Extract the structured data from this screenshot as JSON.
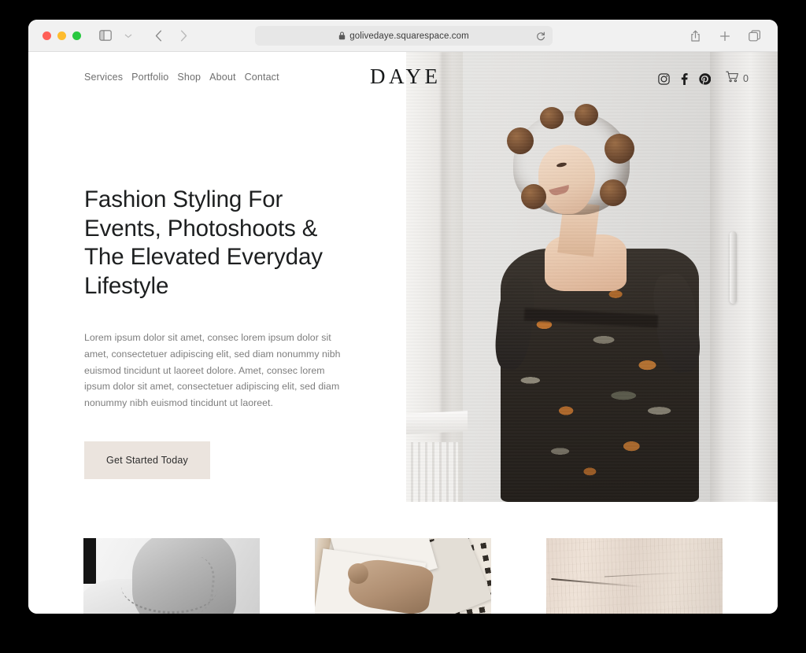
{
  "browser": {
    "url": "golivedaye.squarespace.com",
    "lock_icon": "lock-icon",
    "reload_icon": "reload-icon",
    "sidebar_icon": "sidebar-toggle-icon",
    "chevron_icon": "chevron-down-icon",
    "back_icon": "back-arrow-icon",
    "forward_icon": "forward-arrow-icon",
    "share_icon": "share-icon",
    "new_tab_icon": "plus-icon",
    "tabs_icon": "tabs-overview-icon",
    "traffic_lights": [
      "close-button",
      "minimize-button",
      "maximize-button"
    ]
  },
  "site": {
    "brand": "DAYE",
    "nav": [
      {
        "label": "Services"
      },
      {
        "label": "Portfolio"
      },
      {
        "label": "Shop"
      },
      {
        "label": "About"
      },
      {
        "label": "Contact"
      }
    ],
    "social": [
      {
        "name": "instagram-icon"
      },
      {
        "name": "facebook-icon"
      },
      {
        "name": "pinterest-icon"
      }
    ],
    "cart": {
      "icon": "cart-icon",
      "count": "0"
    },
    "hero": {
      "headline": "Fashion Styling For Events, Photoshoots & The Elevated Everyday Lifestyle",
      "body": "Lorem ipsum dolor sit amet, consec lorem ipsum dolor sit amet, consectetuer adipiscing elit, sed diam nonummy nibh euismod tincidunt ut laoreet dolore. Amet, consec lorem ipsum dolor sit amet, consectetuer adipiscing elit, sed diam nonummy nibh euismod tincidunt ut laoreet.",
      "cta_label": "Get Started Today",
      "image_alt": "smiling-woman-curly-hair-floral-dress"
    },
    "gallery": [
      {
        "alt": "black-and-white-chain-necklace-photo"
      },
      {
        "alt": "scattered-sepia-polaroid-photos"
      },
      {
        "alt": "beige-stone-texture"
      }
    ]
  },
  "colors": {
    "cta_bg": "#ebe4de",
    "text_dark": "#1d1f20",
    "text_muted": "#7d7d7d",
    "page_bg": "#ffffff"
  }
}
